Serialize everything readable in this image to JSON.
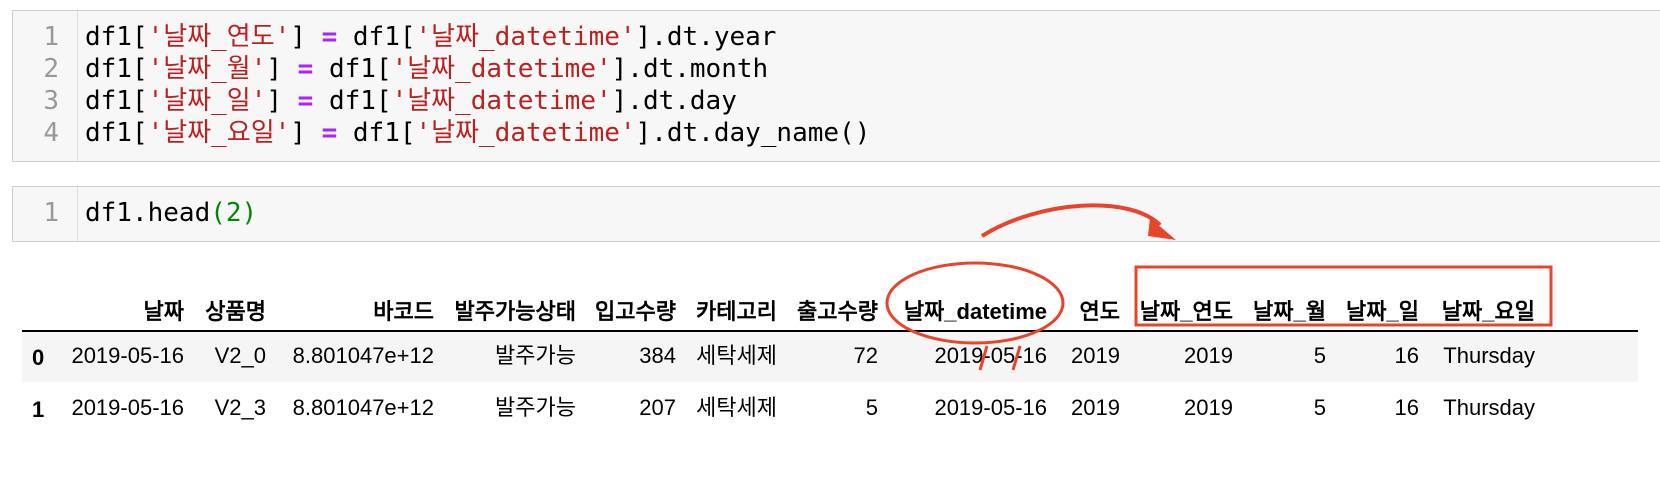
{
  "cells": [
    {
      "lines": [
        {
          "num": "1",
          "parts": [
            [
              "plain",
              "df1["
            ],
            [
              "str",
              "'날짜_연도'"
            ],
            [
              "plain",
              "] "
            ],
            [
              "op",
              "="
            ],
            [
              "plain",
              " df1["
            ],
            [
              "str",
              "'날짜_datetime'"
            ],
            [
              "plain",
              "].dt.year"
            ]
          ]
        },
        {
          "num": "2",
          "parts": [
            [
              "plain",
              "df1["
            ],
            [
              "str",
              "'날짜_월'"
            ],
            [
              "plain",
              "] "
            ],
            [
              "op",
              "="
            ],
            [
              "plain",
              " df1["
            ],
            [
              "str",
              "'날짜_datetime'"
            ],
            [
              "plain",
              "].dt.month"
            ]
          ]
        },
        {
          "num": "3",
          "parts": [
            [
              "plain",
              "df1["
            ],
            [
              "str",
              "'날짜_일'"
            ],
            [
              "plain",
              "] "
            ],
            [
              "op",
              "="
            ],
            [
              "plain",
              " df1["
            ],
            [
              "str",
              "'날짜_datetime'"
            ],
            [
              "plain",
              "].dt.day"
            ]
          ]
        },
        {
          "num": "4",
          "parts": [
            [
              "plain",
              "df1["
            ],
            [
              "str",
              "'날짜_요일'"
            ],
            [
              "plain",
              "] "
            ],
            [
              "op",
              "="
            ],
            [
              "plain",
              " df1["
            ],
            [
              "str",
              "'날짜_datetime'"
            ],
            [
              "plain",
              "].dt.day_name()"
            ]
          ]
        }
      ]
    },
    {
      "lines": [
        {
          "num": "1",
          "parts": [
            [
              "plain",
              "df1.head"
            ],
            [
              "num",
              "(2)"
            ]
          ]
        }
      ]
    }
  ],
  "table": {
    "columns": [
      "날짜",
      "상품명",
      "바코드",
      "발주가능상태",
      "입고수량",
      "카테고리",
      "출고수량",
      "날짜_datetime",
      "연도",
      "날짜_연도",
      "날짜_월",
      "날짜_일",
      "날짜_요일"
    ],
    "rows": [
      {
        "index": "0",
        "cells": [
          "2019-05-16",
          "V2_0",
          "8.801047e+12",
          "발주가능",
          "384",
          "세탁세제",
          "72",
          "2019-05-16",
          "2019",
          "2019",
          "5",
          "16",
          "Thursday"
        ]
      },
      {
        "index": "1",
        "cells": [
          "2019-05-16",
          "V2_3",
          "8.801047e+12",
          "발주가능",
          "207",
          "세탁세제",
          "5",
          "2019-05-16",
          "2019",
          "2019",
          "5",
          "16",
          "Thursday"
        ]
      }
    ]
  },
  "colors": {
    "string": "#ba2121",
    "operator": "#aa22ff",
    "number": "#008800",
    "annotation": "#e8442c",
    "row_band": "#f5f5f5"
  }
}
